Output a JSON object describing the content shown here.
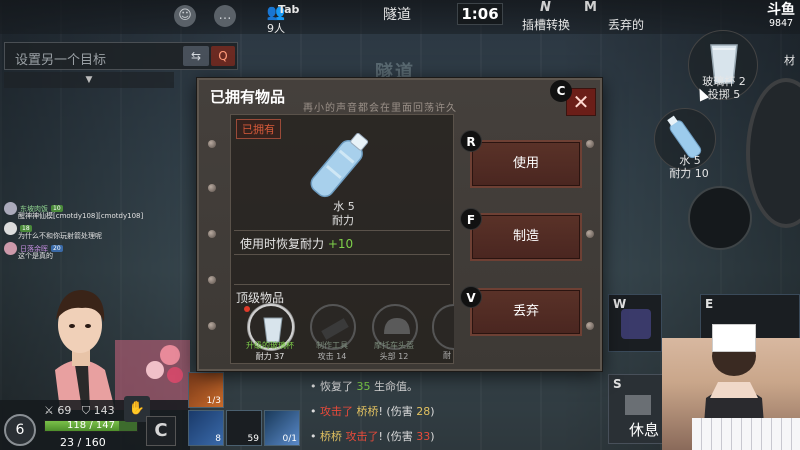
{
  "top_bar": {
    "player_count": "9人",
    "tab_key": "Tab",
    "location": "隧道",
    "timer": "1:06",
    "key_n": "N",
    "key_m": "M",
    "slot_switch": "插槽转换",
    "discard": "丢弃的",
    "corner_logo": "斗鱼",
    "corner_number": "9847"
  },
  "target": {
    "placeholder": "设置另一个目标",
    "swap_icon": "⇆",
    "search_icon": "Q",
    "expand_icon": "▼"
  },
  "chat": [
    {
      "name": "东坡肉饭",
      "level": "10",
      "text": "醒神神仙模[cmotdy108][cmotdy108]"
    },
    {
      "name": "",
      "level": "18",
      "text": "为什么不和你玩射箭处理呢"
    },
    {
      "name": "日落余晖",
      "level": "20",
      "text": "这个是真的"
    }
  ],
  "stats": {
    "level": "6",
    "attack": "69",
    "defense": "143",
    "hp": "118 / 147",
    "hp_fraction": 0.8,
    "stamina": "23 / 160",
    "c_key": "C",
    "slot1_count": "1/3",
    "slot2_count": "8",
    "slot3_count": "59",
    "slot4_count": "0/1"
  },
  "combat_log": [
    {
      "a": "恢复了",
      "num": "35",
      "b": "生命值。"
    },
    {
      "a": "攻击了",
      "who": "桥桥",
      "b": "! (伤害",
      "num": "28",
      "c": ")"
    },
    {
      "a": "桥桥",
      "who": "攻击了",
      "b": "! (伤害",
      "num": "33",
      "c": ")"
    }
  ],
  "right_panel": {
    "item1_name": "玻璃杯 2",
    "item1_stat": "投掷 5",
    "item2_name": "水 5",
    "item2_stat": "耐力 10",
    "partial_label": "材",
    "key_w": "W",
    "key_e": "E",
    "key_s": "S",
    "rest_label": "休息"
  },
  "modal": {
    "bg_title": "隧道",
    "title": "已拥有物品",
    "subtitle": "再小的声音都会在里面回荡许久",
    "close_key": "C",
    "close_icon": "✕",
    "owned_tag": "已拥有",
    "item_name": "水 5",
    "item_stat": "耐力",
    "effect_label": "使用时恢复耐力",
    "effect_value": "+10",
    "category": "顶级物品",
    "inventory": [
      {
        "label_top": "升级的玻璃杯",
        "label_bottom": "耐力 37",
        "selected": true
      },
      {
        "label_top": "制作工具",
        "label_bottom": "攻击 14",
        "selected": false
      },
      {
        "label_top": "摩托车头盔",
        "label_bottom": "头部 12",
        "selected": false
      },
      {
        "label_top": "",
        "label_bottom": "耐",
        "selected": false
      }
    ],
    "actions": [
      {
        "key": "R",
        "label": "使用"
      },
      {
        "key": "F",
        "label": "制造"
      },
      {
        "key": "V",
        "label": "丢弃"
      }
    ]
  }
}
